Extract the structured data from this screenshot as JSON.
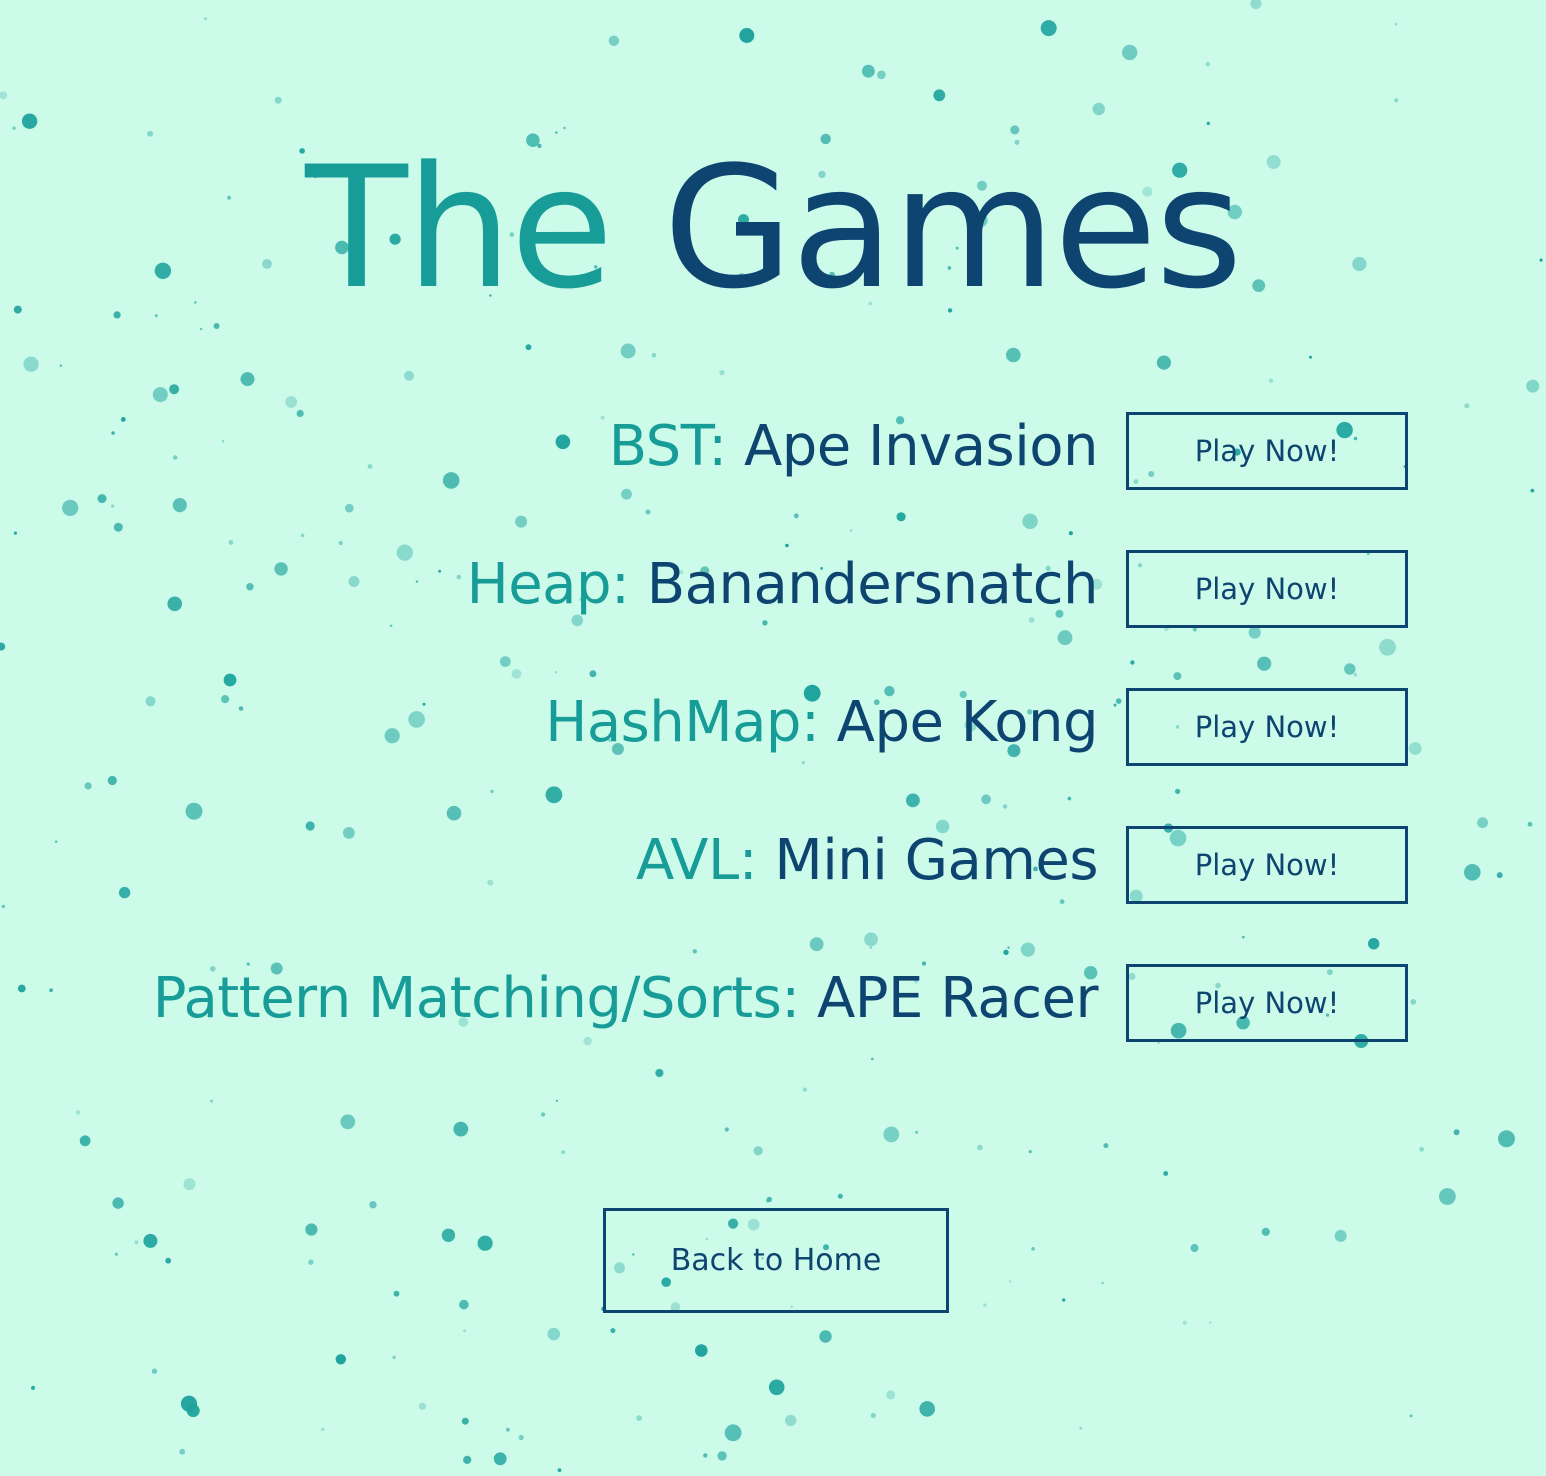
{
  "page": {
    "title_first": "The",
    "title_second": "Games"
  },
  "games": [
    {
      "topic": "BST:",
      "name": "Ape Invasion",
      "button_label": "Play Now!"
    },
    {
      "topic": "Heap:",
      "name": "Banandersnatch",
      "button_label": "Play Now!"
    },
    {
      "topic": "HashMap:",
      "name": "Ape Kong",
      "button_label": "Play Now!"
    },
    {
      "topic": "AVL:",
      "name": "Mini Games",
      "button_label": "Play Now!"
    },
    {
      "topic": "Pattern Matching/Sorts:",
      "name": "APE Racer",
      "button_label": "Play Now!"
    }
  ],
  "footer": {
    "home_label": "Back to Home"
  },
  "theme": {
    "background": "#ccfbea",
    "accent_teal": "#179c98",
    "accent_navy": "#0d4470",
    "dot_color": "#1ea39d"
  }
}
